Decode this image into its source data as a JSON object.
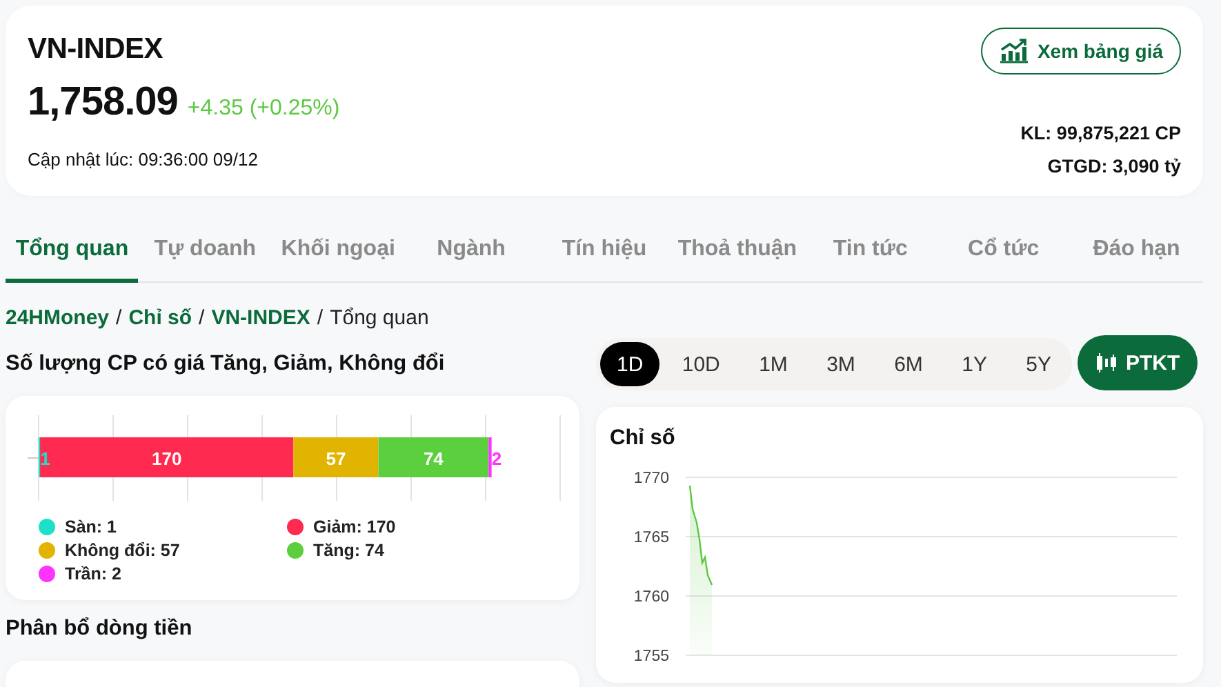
{
  "header": {
    "symbol": "VN-INDEX",
    "price": "1,758.09",
    "change": "+4.35 (+0.25%)",
    "updated": "Cập nhật lúc: 09:36:00 09/12",
    "price_board_button": "Xem bảng giá",
    "volume": "KL: 99,875,221 CP",
    "value": "GTGD: 3,090 tỷ"
  },
  "tabs": [
    {
      "label": "Tổng quan",
      "selected": true
    },
    {
      "label": "Tự doanh",
      "selected": false
    },
    {
      "label": "Khối ngoại",
      "selected": false
    },
    {
      "label": "Ngành",
      "selected": false
    },
    {
      "label": "Tín hiệu",
      "selected": false
    },
    {
      "label": "Thoả thuận",
      "selected": false
    },
    {
      "label": "Tin tức",
      "selected": false
    },
    {
      "label": "Cổ tức",
      "selected": false
    },
    {
      "label": "Đáo hạn",
      "selected": false
    }
  ],
  "breadcrumb": {
    "separator": "/",
    "items": [
      {
        "label": "24HMoney",
        "kind": "link"
      },
      {
        "label": "Chỉ số",
        "kind": "link"
      },
      {
        "label": "VN-INDEX",
        "kind": "link"
      },
      {
        "label": "Tổng quan",
        "kind": "current"
      }
    ]
  },
  "breadth": {
    "title": "Số lượng CP có giá Tăng, Giảm, Không đổi",
    "bar_segments": [
      {
        "value": "1",
        "color": "#1de0c8"
      },
      {
        "value": "170",
        "color": "#ff2a4f"
      },
      {
        "value": "57",
        "color": "#e0b400"
      },
      {
        "value": "74",
        "color": "#5ccf3e"
      },
      {
        "value": "2",
        "color": "#ff33ff"
      }
    ],
    "legend": [
      {
        "label": "Sàn: 1",
        "color": "#1de0c8"
      },
      {
        "label": "Giảm: 170",
        "color": "#ff2a4f"
      },
      {
        "label": "Không đổi: 57",
        "color": "#e0b400"
      },
      {
        "label": "Tăng: 74",
        "color": "#5ccf3e"
      },
      {
        "label": "Trần: 2",
        "color": "#ff33ff"
      }
    ]
  },
  "money_flow": {
    "title": "Phân bổ dòng tiền"
  },
  "periods": [
    {
      "label": "1D",
      "selected": true
    },
    {
      "label": "10D",
      "selected": false
    },
    {
      "label": "1M",
      "selected": false
    },
    {
      "label": "3M",
      "selected": false
    },
    {
      "label": "6M",
      "selected": false
    },
    {
      "label": "1Y",
      "selected": false
    },
    {
      "label": "5Y",
      "selected": false
    }
  ],
  "technical_button": "PTKT",
  "index_chart": {
    "title": "Chỉ số",
    "y_labels": [
      "1770",
      "1765",
      "1760",
      "1755"
    ]
  }
}
